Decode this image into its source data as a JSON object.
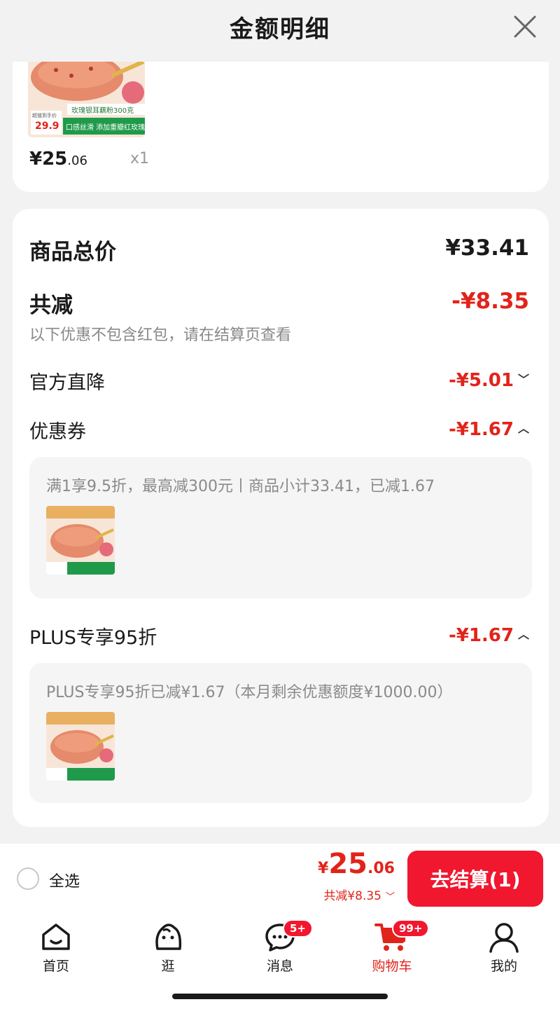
{
  "header": {
    "title": "金额明细"
  },
  "product": {
    "image_text_1": "玫瑰银耳藕粉300克",
    "image_text_2": "口感丝滑 添加重瓣红玫瑰",
    "image_price_label": "超值到手价",
    "image_price": "29.9",
    "price_int": "¥25",
    "price_dec": ".06",
    "qty": "x1"
  },
  "summary": {
    "total_label": "商品总价",
    "total_value": "¥33.41",
    "reduce_label": "共减",
    "reduce_value": "-¥8.35",
    "note": "以下优惠不包含红包，请在结算页查看",
    "items": [
      {
        "label": "官方直降",
        "value": "-¥5.01",
        "chevron": "chevron-down-icon"
      },
      {
        "label": "优惠券",
        "value": "-¥1.67",
        "chevron": "chevron-up-icon"
      },
      {
        "label": "PLUS专享95折",
        "value": "-¥1.67",
        "chevron": "chevron-up-icon"
      }
    ],
    "coupon_detail": "满1享9.5折，最高减300元丨商品小计33.41，已减1.67",
    "plus_detail": "PLUS专享95折已减¥1.67（本月剩余优惠额度¥1000.00）"
  },
  "checkout": {
    "select_all": "全选",
    "yen": "¥",
    "price_int": "25",
    "price_dec": ".06",
    "reduce": "共减¥8.35",
    "button": "去结算(1)"
  },
  "nav": {
    "items": [
      {
        "label": "首页",
        "icon": "home-icon"
      },
      {
        "label": "逛",
        "icon": "browse-icon"
      },
      {
        "label": "消息",
        "icon": "message-icon",
        "badge": "5+"
      },
      {
        "label": "购物车",
        "icon": "cart-icon",
        "badge": "99+"
      },
      {
        "label": "我的",
        "icon": "profile-icon"
      }
    ]
  },
  "colors": {
    "accent_red": "#e2231a",
    "button_red": "#f0172f",
    "background": "#f2f2f2"
  }
}
